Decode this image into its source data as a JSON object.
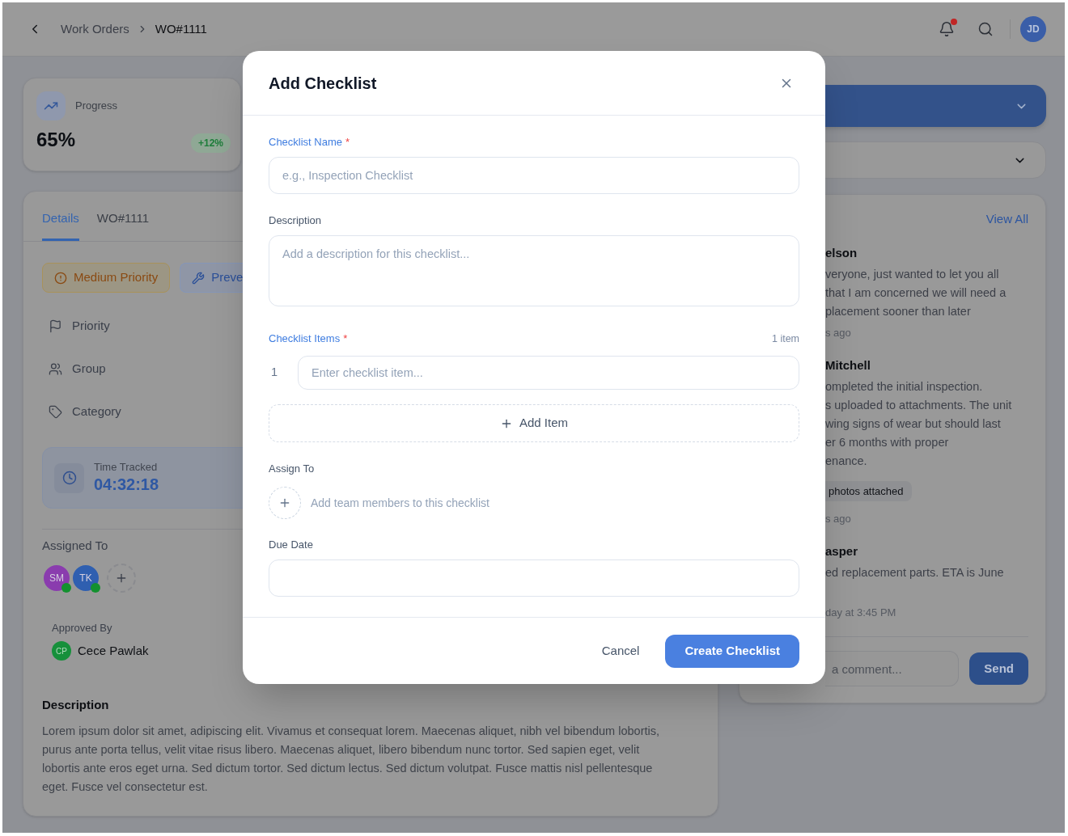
{
  "header": {
    "breadcrumb": [
      {
        "label": "Work Orders",
        "current": false
      },
      {
        "label": "WO#1111",
        "current": true
      }
    ],
    "notifications": {
      "unread": true
    },
    "user": {
      "initials": "JD"
    }
  },
  "progress_card": {
    "label": "Progress",
    "value": "65%",
    "change": "+12%"
  },
  "details_card": {
    "tabs": [
      {
        "label": "Details",
        "selected": true
      },
      {
        "label": "WO#1111",
        "selected": false
      }
    ],
    "chips": [
      {
        "kind": "priority",
        "label": "Medium Priority"
      },
      {
        "kind": "type",
        "label": "Preve"
      }
    ],
    "fields": [
      {
        "kind": "priority",
        "label": "Priority"
      },
      {
        "kind": "group",
        "label": "Group"
      },
      {
        "kind": "category",
        "label": "Category"
      }
    ],
    "time_tracked": {
      "label": "Time Tracked",
      "value": "04:32:18"
    },
    "assigned_to": {
      "label": "Assigned To",
      "members": [
        {
          "initials": "SM",
          "color": "#8a3cae",
          "online": true
        },
        {
          "initials": "TK",
          "color": "#2f5fb0",
          "online": true
        }
      ]
    },
    "approved_by": {
      "label": "Approved By",
      "initials": "CP",
      "name": "Cece Pawlak"
    },
    "description": {
      "title": "Description",
      "text": "Lorem ipsum dolor sit amet, adipiscing elit. Vivamus et consequat lorem. Maecenas aliquet, nibh vel bibendum lobortis, purus ante porta tellus, velit vitae risus libero. Maecenas aliquet, libero bibendum nunc tortor. Sed sapien eget, velit lobortis ante eros eget urna. Sed dictum tortor. Sed dictum lectus. Sed dictum volutpat. Fusce mattis nisl pellentesque eget. Fusce vel consectetur est."
    }
  },
  "comments_card": {
    "view_all": "View All",
    "comments": [
      {
        "author": "elson",
        "lines": [
          "veryone, just wanted to let you all",
          "that I am concerned we will need a",
          "placement sooner than later"
        ],
        "time": "s ago"
      },
      {
        "author": "Mitchell",
        "lines": [
          "ompleted the initial inspection.",
          "s uploaded to attachments. The unit",
          "wing signs of wear but should last",
          "er 6 months with proper",
          "enance."
        ],
        "attachment": "photos attached",
        "time": "s ago"
      },
      {
        "author": "asper",
        "lines": [
          "ed replacement parts. ETA is June"
        ],
        "time": "day at 3:45 PM"
      }
    ],
    "comment_input": {
      "placeholder": "a comment..."
    },
    "send_button": "Send"
  },
  "modal": {
    "title": "Add Checklist",
    "fields": [
      {
        "kind": "text",
        "label": "Checklist Name",
        "required_mark": "*",
        "placeholder": "e.g., Inspection Checklist"
      },
      {
        "kind": "textarea",
        "label": "Description",
        "placeholder": "Add a description for this checklist..."
      },
      {
        "kind": "items",
        "label": "Checklist Items",
        "required_mark": "*",
        "count": "1 item",
        "items": [
          {
            "number": "1",
            "placeholder": "Enter checklist item..."
          }
        ],
        "add_button": "Add Item"
      },
      {
        "kind": "assignees",
        "label": "Assign To",
        "hint": "Add team members to this checklist"
      },
      {
        "kind": "date",
        "label": "Due Date"
      }
    ],
    "buttons": [
      {
        "kind": "secondary",
        "label": "Cancel"
      },
      {
        "kind": "primary",
        "label": "Create Checklist"
      }
    ]
  }
}
